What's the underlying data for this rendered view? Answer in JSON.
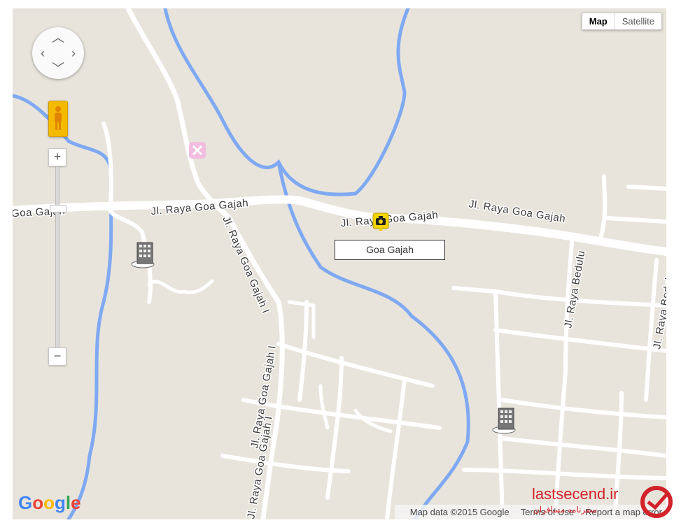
{
  "map": {
    "type_control": {
      "map_label": "Map",
      "satellite_label": "Satellite",
      "selected": "Map"
    },
    "zoom": {
      "in_label": "+",
      "out_label": "−",
      "level_fraction": 0.78
    },
    "pan_icons": {
      "up": "chevron-up-icon",
      "down": "chevron-down-icon",
      "left": "chevron-left-icon",
      "right": "chevron-right-icon"
    },
    "road_labels": {
      "main_west": "Goa Gajah",
      "main_center": "Jl. Raya Goa Gajah",
      "main_east_1": "Jl. Raya Goa Gajah",
      "main_east_2": "Jl. Raya Goa Gajah",
      "south_1": "Jl. Raya Goa Gajah I",
      "south_2": "Jl. Raya Goa Gajah I",
      "south_3": "Jl. Raya Goa Gajah I",
      "bedulu_1": "Jl. Raya Bedulu",
      "bedulu_2": "Jl. Raya Bedulu"
    },
    "place_label": "Goa Gajah",
    "marker_icon": "camera-marker-icon",
    "poi_icons": [
      "building-icon",
      "building-icon",
      "restaurant-icon"
    ],
    "colors": {
      "land": "#e8e4dc",
      "road": "#ffffff",
      "water": "#7fa9f2",
      "marker": "#f5d500"
    }
  },
  "footer": {
    "logo": "Google",
    "map_data": "Map data ©2015 Google",
    "terms": "Terms of Use",
    "report": "Report a map error"
  },
  "watermark": {
    "text": "lastsecend.ir",
    "subtext": "سفرنامه مسافران"
  }
}
